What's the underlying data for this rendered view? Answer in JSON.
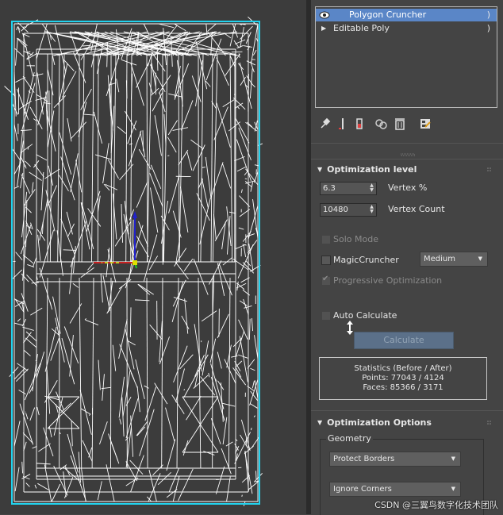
{
  "modifier_stack": {
    "items": [
      {
        "label": "Polygon Cruncher",
        "selected": true,
        "has_eye": true
      },
      {
        "label": "Editable Poly",
        "selected": false,
        "has_eye": false
      }
    ]
  },
  "stack_toolbar": {
    "icons": [
      "pin-stack-icon",
      "show-end-result-icon",
      "make-unique-icon",
      "remove-modifier-icon",
      "configure-modifier-sets-icon"
    ]
  },
  "optimization_level": {
    "title": "Optimization level",
    "vertex_percent": {
      "value": "6.3",
      "label": "Vertex %"
    },
    "vertex_count": {
      "value": "10480",
      "label": "Vertex Count"
    },
    "solo_mode": {
      "label": "Solo Mode",
      "checked": false,
      "enabled": false
    },
    "magic_cruncher": {
      "label": "MagicCruncher",
      "checked": false,
      "enabled": true
    },
    "magic_level": {
      "value": "Medium"
    },
    "progressive": {
      "label": "Progressive Optimization",
      "checked": true,
      "enabled": false
    },
    "auto_calculate": {
      "label": "Auto Calculate",
      "checked": false,
      "enabled": false
    },
    "calculate_label": "Calculate",
    "statistics": {
      "title": "Statistics (Before / After)",
      "points": "Points: 77043 / 4124",
      "faces": "Faces: 85366 / 3171"
    }
  },
  "optimization_options": {
    "title": "Optimization Options",
    "geometry_group": "Geometry",
    "borders": {
      "value": "Protect Borders"
    },
    "corners": {
      "value": "Ignore Corners"
    }
  },
  "watermark": "CSDN @三翼鸟数字化技术团队",
  "colors": {
    "selection": "#5a86c7",
    "viewport_bg": "#3c3c3c",
    "wire": "#ffffff",
    "outline": "#22d3ee"
  }
}
